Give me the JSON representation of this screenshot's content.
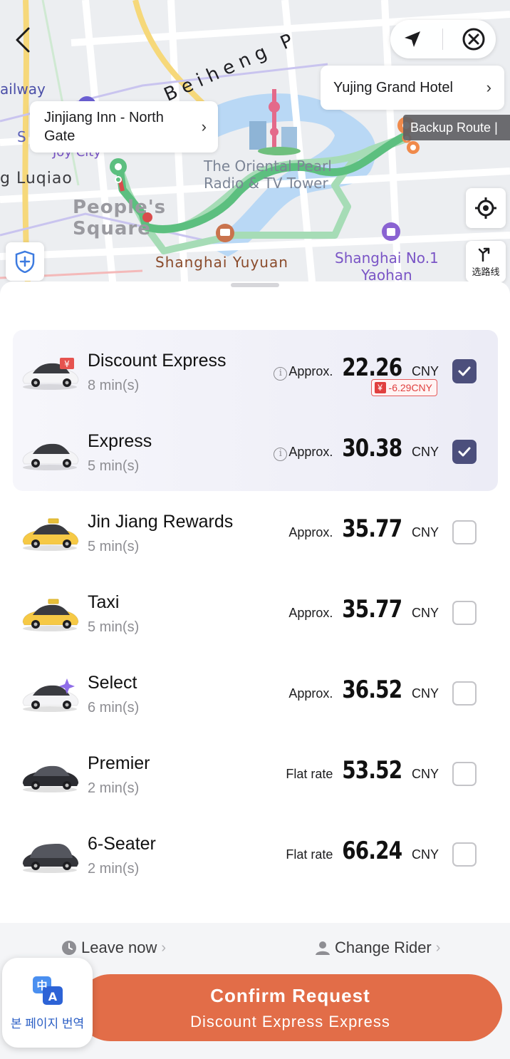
{
  "map": {
    "labels": {
      "beiheng": "Beiheng P",
      "railway": "ailway",
      "joy_city": "Joy City",
      "luqiao": "g Luqiao",
      "peoples_square": "People's\nSquare",
      "oriental_pearl": "The Oriental Pearl\nRadio & TV Tower",
      "yuyuan": "Shanghai Yuyuan",
      "yaohan": "Shanghai No.1\nYaohan",
      "s_letter": "S",
      "route_picker_label": "选路线"
    },
    "destination": {
      "label": "Yujing Grand Hotel"
    },
    "origin": {
      "label": "Jinjiang Inn - North Gate"
    },
    "backup_route": "Backup Route |",
    "colors": {
      "route_primary": "#5cbf7f",
      "route_secondary": "#a6dcb6",
      "destination_pin": "#f08a4b",
      "river": "#b9d8f5"
    }
  },
  "rides": [
    {
      "name": "Discount Express",
      "eta": "8 min(s)",
      "price_prefix": "Approx.",
      "amount": "22.26",
      "currency": "CNY",
      "info_icon": true,
      "discount": "-6.29CNY",
      "checked": true,
      "car": "white-discount"
    },
    {
      "name": "Express",
      "eta": "5 min(s)",
      "price_prefix": "Approx.",
      "amount": "30.38",
      "currency": "CNY",
      "info_icon": true,
      "checked": true,
      "car": "white"
    },
    {
      "name": "Jin Jiang Rewards",
      "eta": "5 min(s)",
      "price_prefix": "Approx.",
      "amount": "35.77",
      "currency": "CNY",
      "info_icon": false,
      "checked": false,
      "car": "yellow-taxi"
    },
    {
      "name": "Taxi",
      "eta": "5 min(s)",
      "price_prefix": "Approx.",
      "amount": "35.77",
      "currency": "CNY",
      "info_icon": false,
      "checked": false,
      "car": "yellow-taxi"
    },
    {
      "name": "Select",
      "eta": "6 min(s)",
      "price_prefix": "Approx.",
      "amount": "36.52",
      "currency": "CNY",
      "info_icon": false,
      "checked": false,
      "car": "white-sparkle"
    },
    {
      "name": "Premier",
      "eta": "2 min(s)",
      "price_prefix": "Flat rate",
      "amount": "53.52",
      "currency": "CNY",
      "info_icon": false,
      "checked": false,
      "car": "black"
    },
    {
      "name": "6-Seater",
      "eta": "2 min(s)",
      "price_prefix": "Flat rate",
      "amount": "66.24",
      "currency": "CNY",
      "info_icon": false,
      "checked": false,
      "car": "black-van"
    }
  ],
  "footer": {
    "leave_now": "Leave now",
    "change_rider": "Change Rider",
    "confirm_main": "Confirm Request",
    "confirm_sub": "Discount Express Express"
  },
  "translate": {
    "label": "본 페이지 번역",
    "icon_top": "中",
    "icon_bottom": "A"
  },
  "colors": {
    "accent": "#e26d48",
    "checkbox_checked": "#4c4f7c",
    "discount_red": "#e0403f"
  }
}
